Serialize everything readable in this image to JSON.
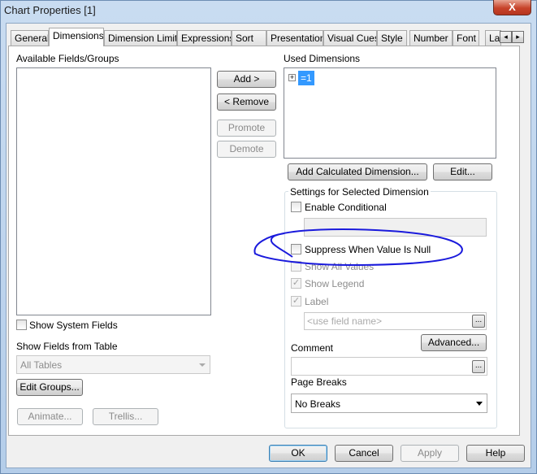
{
  "window": {
    "title": "Chart Properties [1]",
    "close_label": "X"
  },
  "tabs": [
    {
      "label": "General"
    },
    {
      "label": "Dimensions",
      "active": true
    },
    {
      "label": "Dimension Limits"
    },
    {
      "label": "Expressions"
    },
    {
      "label": "Sort"
    },
    {
      "label": "Presentation"
    },
    {
      "label": "Visual Cues"
    },
    {
      "label": "Style"
    },
    {
      "label": "Number"
    },
    {
      "label": "Font"
    },
    {
      "label": "La"
    }
  ],
  "tab_scroll": {
    "left": "◂",
    "right": "▸"
  },
  "available": {
    "label": "Available Fields/Groups",
    "items": []
  },
  "transfer": {
    "add": "Add >",
    "remove": "< Remove",
    "promote": "Promote",
    "demote": "Demote"
  },
  "used": {
    "label": "Used Dimensions",
    "items": [
      {
        "expander": "+",
        "label": "=1",
        "selected": true
      }
    ]
  },
  "used_buttons": {
    "add_calc": "Add Calculated Dimension...",
    "edit": "Edit..."
  },
  "settings": {
    "group_label": "Settings for Selected Dimension",
    "enable_conditional": {
      "label": "Enable Conditional",
      "checked": false
    },
    "suppress_null": {
      "label": "Suppress When Value Is Null",
      "checked": false
    },
    "show_all_values": {
      "label": "Show All Values",
      "checked": false,
      "disabled": true
    },
    "show_legend": {
      "label": "Show Legend",
      "checked": true,
      "disabled": true
    },
    "label": {
      "label": "Label",
      "checked": true,
      "disabled": true,
      "placeholder": "<use field name>"
    },
    "ellipsis": "...",
    "advanced": "Advanced...",
    "comment_label": "Comment",
    "page_breaks_label": "Page Breaks",
    "page_breaks_value": "No Breaks"
  },
  "left_bottom": {
    "show_system_fields": "Show System Fields",
    "show_fields_from_table": "Show Fields from Table",
    "table_value": "All Tables",
    "edit_groups": "Edit Groups...",
    "animate": "Animate...",
    "trellis": "Trellis..."
  },
  "footer": {
    "ok": "OK",
    "cancel": "Cancel",
    "apply": "Apply",
    "help": "Help"
  },
  "annotation_color": "#1a1adc"
}
